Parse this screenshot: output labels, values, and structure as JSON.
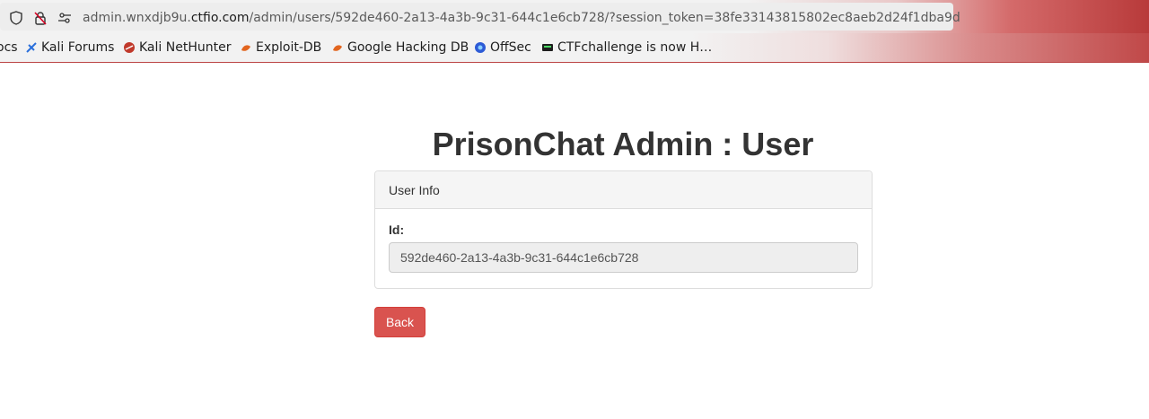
{
  "browser": {
    "url_prefix": "admin.wnxdjb9u.",
    "url_host": "ctfio.com",
    "url_path": "/admin/users/592de460-2a13-4a3b-9c31-644c1e6cb728/?session_token=38fe33143815802ec8aeb2d24f1dba9d"
  },
  "bookmarks": [
    {
      "label": "ocs",
      "icon": "none"
    },
    {
      "label": "Kali Forums",
      "icon": "kali-dragon-icon"
    },
    {
      "label": "Kali NetHunter",
      "icon": "nethunter-icon"
    },
    {
      "label": "Exploit-DB",
      "icon": "exploitdb-icon"
    },
    {
      "label": "Google Hacking DB",
      "icon": "ghdb-icon"
    },
    {
      "label": "OffSec",
      "icon": "offsec-icon"
    },
    {
      "label": "CTFchallenge is now H…",
      "icon": "ctf-icon"
    }
  ],
  "page": {
    "title": "PrisonChat Admin : User",
    "panel_heading": "User Info",
    "id_label": "Id:",
    "id_value": "592de460-2a13-4a3b-9c31-644c1e6cb728",
    "back_label": "Back"
  },
  "colors": {
    "danger": "#d9534f",
    "panel_heading_bg": "#f5f5f5",
    "text": "#333333"
  }
}
